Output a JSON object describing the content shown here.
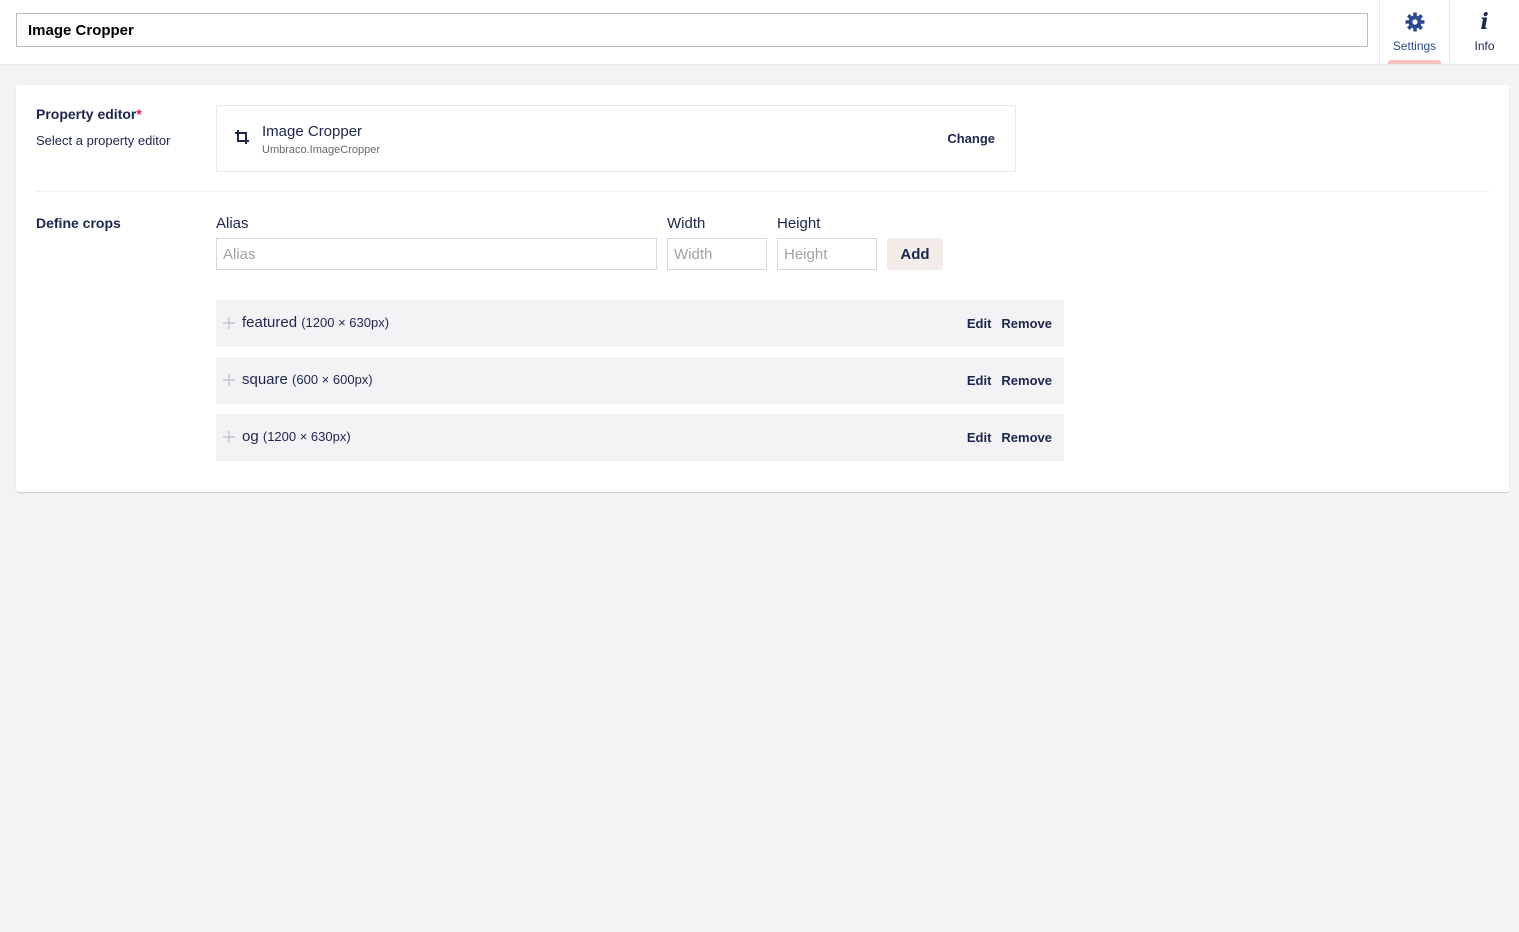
{
  "header": {
    "name_value": "Image Cropper",
    "tabs": [
      {
        "label": "Settings",
        "icon": "gear-icon",
        "active": true
      },
      {
        "label": "Info",
        "icon": "info-icon",
        "active": false
      }
    ]
  },
  "property_editor": {
    "label": "Property editor",
    "required_mark": "*",
    "description": "Select a property editor",
    "selected_name": "Image Cropper",
    "selected_alias": "Umbraco.ImageCropper",
    "icon": "crop-icon",
    "change_label": "Change"
  },
  "define_crops": {
    "label": "Define crops",
    "alias_label": "Alias",
    "alias_placeholder": "Alias",
    "width_label": "Width",
    "width_placeholder": "Width",
    "height_label": "Height",
    "height_placeholder": "Height",
    "add_label": "Add",
    "crops": [
      {
        "alias": "featured",
        "dims": "(1200 × 630px)",
        "edit": "Edit",
        "remove": "Remove"
      },
      {
        "alias": "square",
        "dims": "(600 × 600px)",
        "edit": "Edit",
        "remove": "Remove"
      },
      {
        "alias": "og",
        "dims": "(1200 × 630px)",
        "edit": "Edit",
        "remove": "Remove"
      }
    ]
  },
  "colors": {
    "accent": "#2c4a8d",
    "text": "#1b264f",
    "required": "#d42054",
    "active_tab_indicator": "#f5c1bc"
  }
}
